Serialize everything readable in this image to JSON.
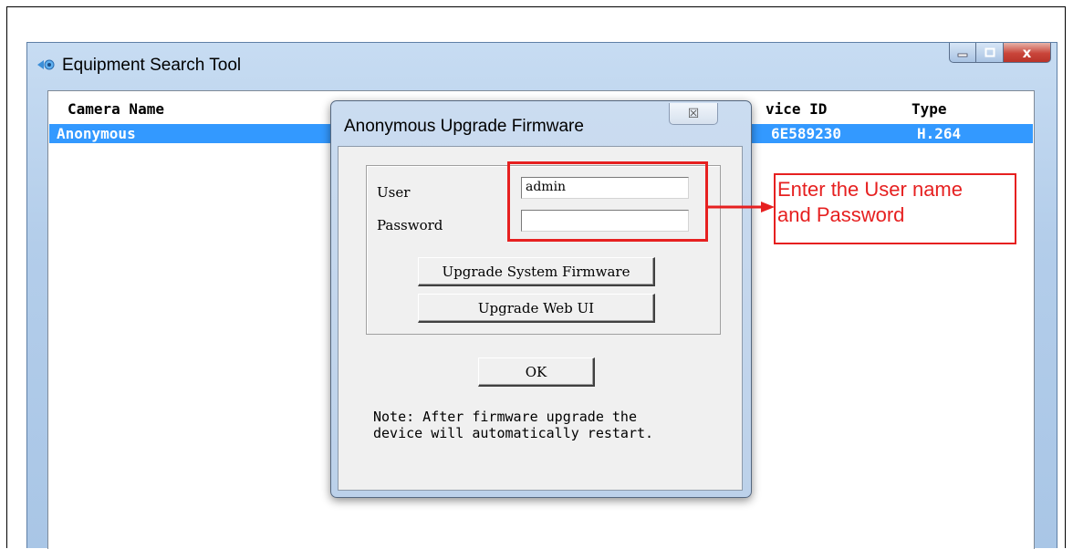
{
  "window": {
    "title": "Equipment Search Tool",
    "close_glyph": "x"
  },
  "list": {
    "columns": [
      "Camera Name",
      "vice ID",
      "Type"
    ],
    "rows": [
      {
        "camera_name": "Anonymous",
        "device_id": "6E589230",
        "type": "H.264"
      }
    ]
  },
  "dialog": {
    "title": "Anonymous Upgrade Firmware",
    "close_glyph": "☒",
    "user_label": "User",
    "user_value": "admin",
    "password_label": "Password",
    "password_value": "",
    "upgrade_system_firmware": "Upgrade System Firmware",
    "upgrade_web_ui": "Upgrade Web UI",
    "ok": "OK",
    "note_line1": "Note: After firmware upgrade the",
    "note_line2": "device will automatically restart."
  },
  "annotation": {
    "line1": "Enter the User name",
    "line2": "and Password",
    "color": "#e62020"
  }
}
